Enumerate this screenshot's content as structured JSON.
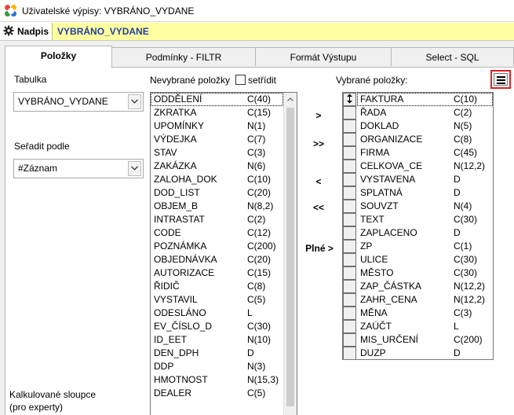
{
  "window": {
    "title": "Uživatelské výpisy: VYBRÁNO_VYDANE"
  },
  "namebar": {
    "label": "Nadpis",
    "value": "VYBRÁNO_VYDANE"
  },
  "tabs": [
    {
      "label": "Položky",
      "active": true
    },
    {
      "label": "Podmínky - FILTR",
      "active": false
    },
    {
      "label": "Formát Výstupu",
      "active": false
    },
    {
      "label": "Select - SQL",
      "active": false
    }
  ],
  "left": {
    "table_label": "Tabulka",
    "table_value": "VYBRÁNO_VYDANE",
    "sort_label": "Seřadit podle",
    "sort_value": "#Záznam",
    "calc_label_line1": "Kalkulované sloupce",
    "calc_label_line2": "(pro experty)"
  },
  "unselected": {
    "label": "Nevybrané položky",
    "sort_checkbox_label": "setřídit",
    "items": [
      [
        "ODDĚLENÍ",
        "C(40)"
      ],
      [
        "ZKRATKA",
        "C(15)"
      ],
      [
        "UPOMÍNKY",
        "N(1)"
      ],
      [
        "VÝDEJKA",
        "C(7)"
      ],
      [
        "STAV",
        "C(3)"
      ],
      [
        "ZAKÁZKA",
        "N(6)"
      ],
      [
        "ZALOHA_DOK",
        "C(10)"
      ],
      [
        "DOD_LIST",
        "C(20)"
      ],
      [
        "OBJEM_B",
        "N(8,2)"
      ],
      [
        "INTRASTAT",
        "C(2)"
      ],
      [
        "CODE",
        "C(12)"
      ],
      [
        "POZNÁMKA",
        "C(200)"
      ],
      [
        "OBJEDNÁVKA",
        "C(20)"
      ],
      [
        "AUTORIZACE",
        "C(15)"
      ],
      [
        "ŘIDIČ",
        "C(8)"
      ],
      [
        "VYSTAVIL",
        "C(5)"
      ],
      [
        "ODESLÁNO",
        "L"
      ],
      [
        "EV_ČÍSLO_D",
        "C(30)"
      ],
      [
        "ID_EET",
        "N(10)"
      ],
      [
        "DEN_DPH",
        "D"
      ],
      [
        "DDP",
        "N(3)"
      ],
      [
        "HMOTNOST",
        "N(15,3)"
      ],
      [
        "DEALER",
        "C(5)"
      ]
    ]
  },
  "movers": {
    "add": ">",
    "add_all": ">>",
    "remove": "<",
    "remove_all": "<<",
    "full": "Plné >"
  },
  "selected": {
    "label": "Vybrané položky:",
    "items": [
      [
        "FAKTURA",
        "C(10)"
      ],
      [
        "ŘADA",
        "C(2)"
      ],
      [
        "DOKLAD",
        "N(5)"
      ],
      [
        "ORGANIZACE",
        "C(8)"
      ],
      [
        "FIRMA",
        "C(45)"
      ],
      [
        "CELKOVA_CE",
        "N(12,2)"
      ],
      [
        "VYSTAVENA",
        "D"
      ],
      [
        "SPLATNÁ",
        "D"
      ],
      [
        "SOUVZT",
        "N(4)"
      ],
      [
        "TEXT",
        "C(30)"
      ],
      [
        "ZAPLACENO",
        "D"
      ],
      [
        "ZP",
        "C(1)"
      ],
      [
        "ULICE",
        "C(30)"
      ],
      [
        "MĚSTO",
        "C(30)"
      ],
      [
        "ZAP_ČÁSTKA",
        "N(12,2)"
      ],
      [
        "ZAHR_CENA",
        "N(12,2)"
      ],
      [
        "MĚNA",
        "C(3)"
      ],
      [
        "ZAÚČT",
        "L"
      ],
      [
        "MIS_URČENÍ",
        "C(200)"
      ],
      [
        "DUZP",
        "D"
      ]
    ]
  },
  "icons": {
    "app": "app-flower-icon",
    "gear": "gear-icon",
    "dropdown": "chevron-down-icon",
    "scroll_up": "scroll-up-arrow-icon",
    "drag": "drag-handle-icon",
    "menu": "hamburger-menu-icon"
  },
  "colors": {
    "namebar_bg": "#ffffa0",
    "name_value": "#1e3ca8",
    "menu_border": "#e02020"
  }
}
